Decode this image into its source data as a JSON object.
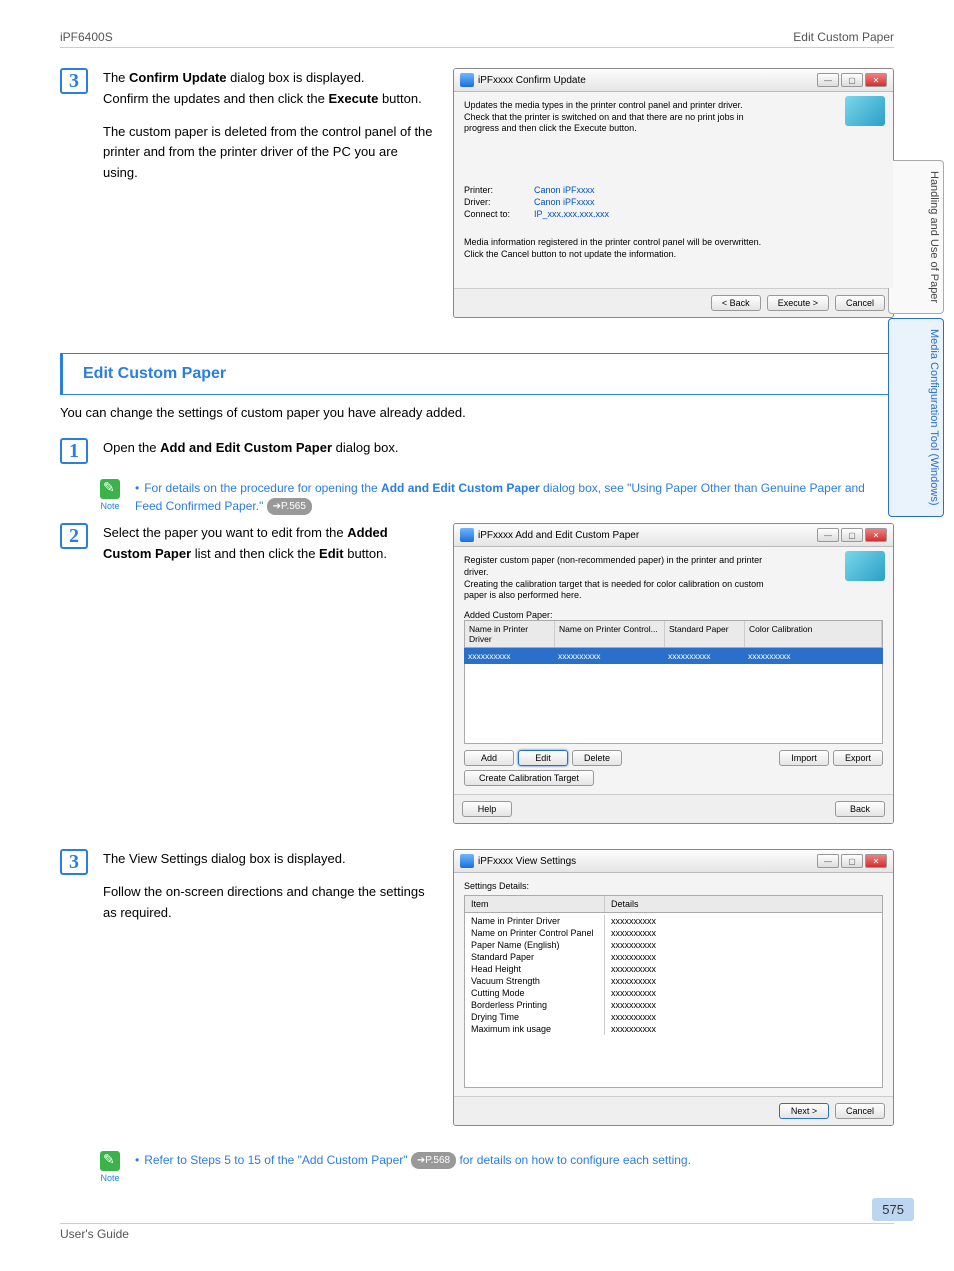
{
  "header": {
    "left": "iPF6400S",
    "right": "Edit Custom Paper"
  },
  "sideTabs": {
    "tab1": "Handling and Use of Paper",
    "tab2": "Media Configuration Tool (Windows)"
  },
  "step3a": {
    "num": "3",
    "p1a": "The ",
    "p1b": "Confirm Update",
    "p1c": " dialog box is displayed.",
    "p2a": "Confirm the updates and then click the ",
    "p2b": "Execute",
    "p2c": " button.",
    "p3": "The custom paper is deleted from the control panel of the printer and from the printer driver of the PC you are using."
  },
  "dlg1": {
    "title": "iPFxxxx Confirm Update",
    "desc": "Updates the media types in the printer control panel and printer driver.\nCheck that the printer is switched on and that there are no print jobs in progress and then click the Execute button.",
    "rows": {
      "printer_lbl": "Printer:",
      "printer_val": "Canon iPFxxxx",
      "driver_lbl": "Driver:",
      "driver_val": "Canon iPFxxxx",
      "connect_lbl": "Connect to:",
      "connect_val": "IP_xxx.xxx.xxx.xxx"
    },
    "note": "Media information registered in the printer control panel will be overwritten.\nClick the Cancel button to not update the information.",
    "btn_back": "< Back",
    "btn_exec": "Execute >",
    "btn_cancel": "Cancel"
  },
  "section": {
    "title": "Edit Custom Paper",
    "desc": "You can change the settings of custom paper you have already added."
  },
  "step1": {
    "num": "1",
    "p1a": "Open the ",
    "p1b": "Add and Edit Custom Paper",
    "p1c": " dialog box."
  },
  "note1": {
    "label": "Note",
    "text_a": "For details on the procedure for opening the ",
    "text_b": "Add and Edit Custom Paper",
    "text_c": " dialog box, see \"Using Paper Other than Genuine Paper and Feed Confirmed Paper.\"",
    "ref": "➔P.565"
  },
  "step2": {
    "num": "2",
    "p1a": "Select the paper you want to edit from the ",
    "p1b": "Added Custom Paper",
    "p1c": " list and then click the ",
    "p1d": "Edit",
    "p1e": " button."
  },
  "dlg2": {
    "title": "iPFxxxx Add and Edit Custom Paper",
    "desc": "Register custom paper (non-recommended paper) in the printer and printer driver.\nCreating the calibration target that is needed for color calibration on custom paper is also performed here.",
    "list_label": "Added Custom Paper:",
    "hdr1": "Name in Printer Driver",
    "hdr2": "Name on Printer Control...",
    "hdr3": "Standard Paper",
    "hdr4": "Color Calibration",
    "row1": "xxxxxxxxxx",
    "row2": "xxxxxxxxxx",
    "row3": "xxxxxxxxxx",
    "row4": "xxxxxxxxxx",
    "btn_add": "Add",
    "btn_edit": "Edit",
    "btn_delete": "Delete",
    "btn_import": "Import",
    "btn_export": "Export",
    "btn_calib": "Create Calibration Target",
    "btn_help": "Help",
    "btn_back2": "Back"
  },
  "step3b": {
    "num": "3",
    "p1": "The View Settings dialog box is displayed.",
    "p2": "Follow the on-screen directions and change the settings as required."
  },
  "dlg3": {
    "title": "iPFxxxx View Settings",
    "label": "Settings Details:",
    "hdr1": "Item",
    "hdr2": "Details",
    "rows": [
      {
        "k": "Name in Printer Driver",
        "v": "xxxxxxxxxx"
      },
      {
        "k": "Name on Printer Control Panel",
        "v": "xxxxxxxxxx"
      },
      {
        "k": "Paper Name (English)",
        "v": "xxxxxxxxxx"
      },
      {
        "k": "Standard Paper",
        "v": "xxxxxxxxxx"
      },
      {
        "k": "Head Height",
        "v": "xxxxxxxxxx"
      },
      {
        "k": "Vacuum Strength",
        "v": "xxxxxxxxxx"
      },
      {
        "k": "Cutting Mode",
        "v": "xxxxxxxxxx"
      },
      {
        "k": "Borderless Printing",
        "v": "xxxxxxxxxx"
      },
      {
        "k": "Drying Time",
        "v": "xxxxxxxxxx"
      },
      {
        "k": "Maximum ink usage",
        "v": "xxxxxxxxxx"
      }
    ],
    "btn_next": "Next >",
    "btn_cancel": "Cancel"
  },
  "note2": {
    "label": "Note",
    "text_a": "Refer to Steps 5 to 15 of the \"Add Custom Paper\"",
    "ref": "➔P.568",
    "text_b": " for details on how to configure each setting."
  },
  "footer": {
    "left": "User's Guide",
    "pagenum": "575"
  }
}
